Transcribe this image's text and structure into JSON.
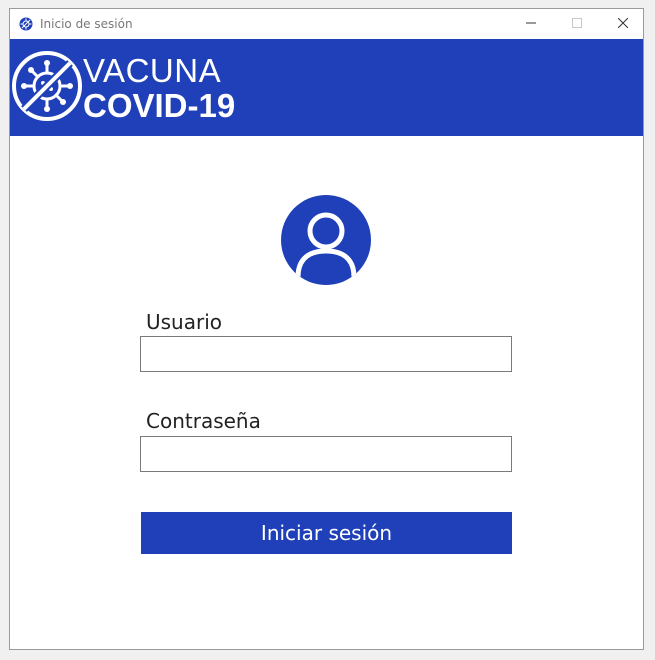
{
  "window": {
    "title": "Inicio de sesión",
    "icon": "virus-icon"
  },
  "banner": {
    "logo_icon": "crossed-virus-icon",
    "line1": "VACUNA",
    "line2": "COVID-19"
  },
  "form": {
    "avatar_icon": "user-icon",
    "username_label": "Usuario",
    "username_value": "",
    "password_label": "Contraseña",
    "password_value": "",
    "login_button": "Iniciar sesión"
  },
  "colors": {
    "brand": "#1f40b8",
    "background": "#ffffff"
  }
}
